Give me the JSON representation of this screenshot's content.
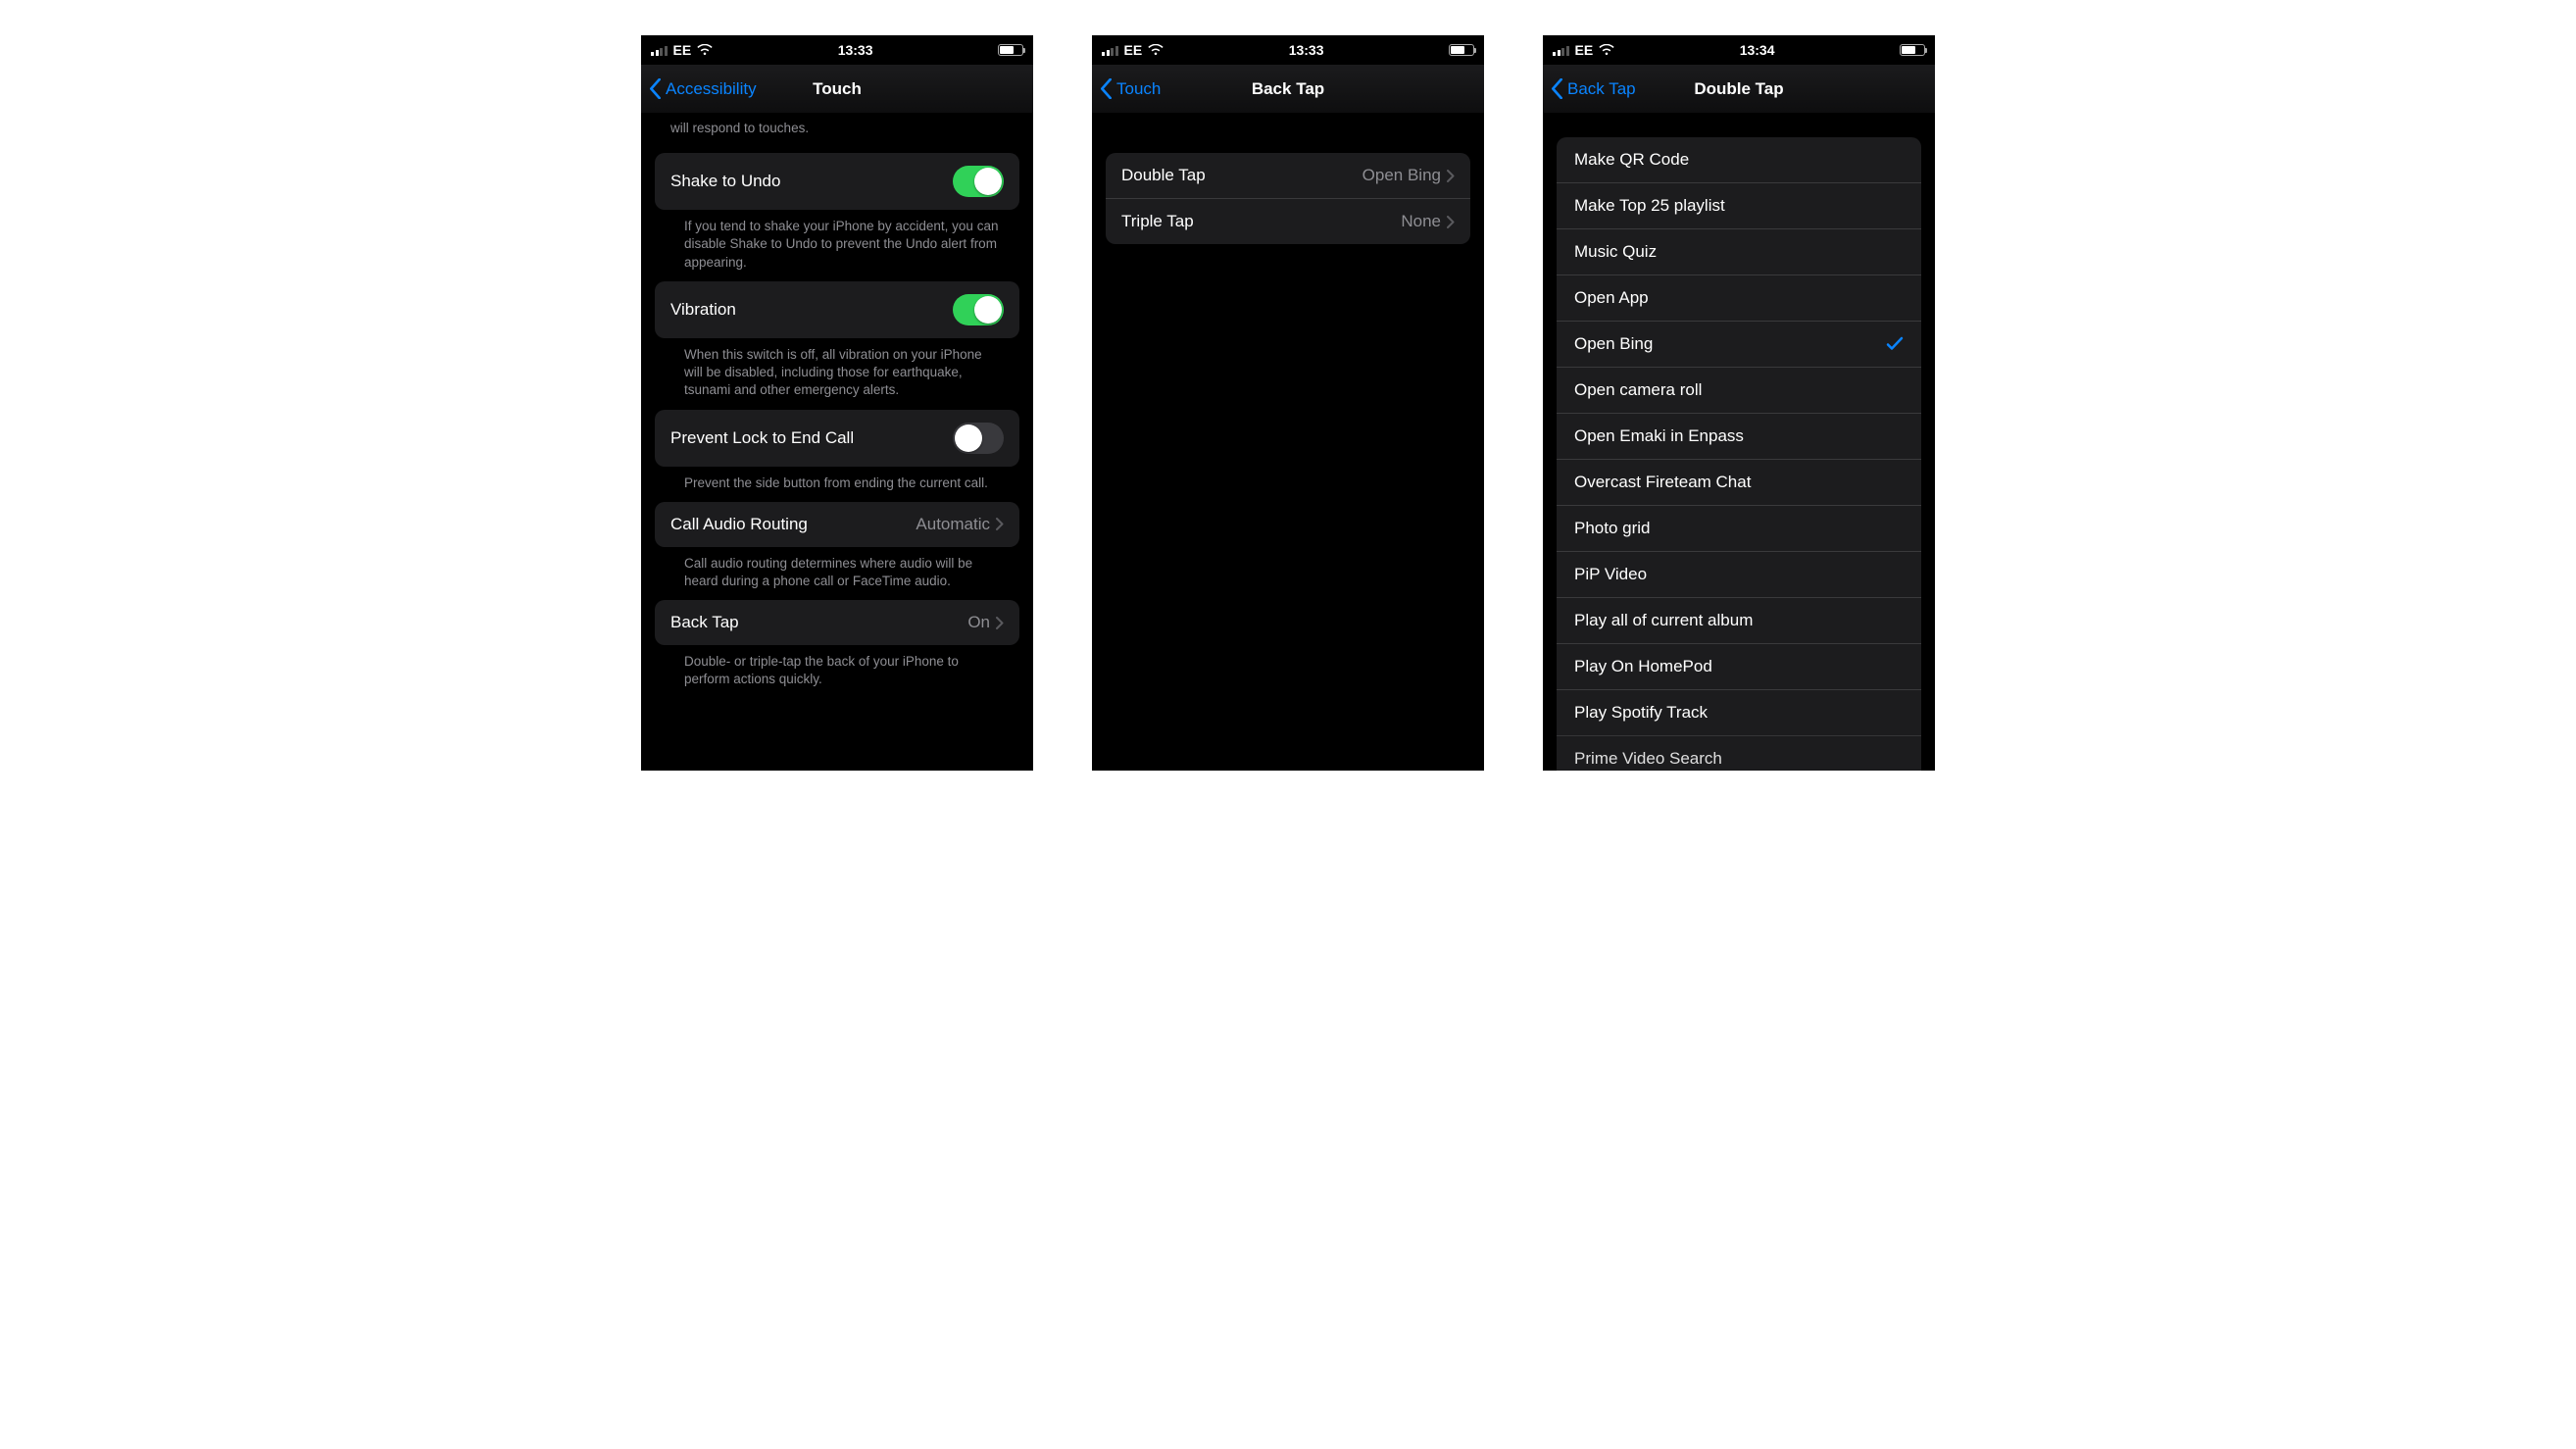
{
  "screens": [
    {
      "status": {
        "carrier": "EE",
        "time": "13:33"
      },
      "nav": {
        "back": "Accessibility",
        "title": "Touch"
      },
      "cut_text_top": "will respond to touches.",
      "rows": {
        "shake": {
          "label": "Shake to Undo",
          "footer": "If you tend to shake your iPhone by accident, you can disable Shake to Undo to prevent the Undo alert from appearing.",
          "on": true
        },
        "vibration": {
          "label": "Vibration",
          "footer": "When this switch is off, all vibration on your iPhone will be disabled, including those for earthquake, tsunami and other emergency alerts.",
          "on": true
        },
        "prevent_lock": {
          "label": "Prevent Lock to End Call",
          "footer": "Prevent the side button from ending the current call.",
          "on": false
        },
        "call_audio": {
          "label": "Call Audio Routing",
          "value": "Automatic",
          "footer": "Call audio routing determines where audio will be heard during a phone call or FaceTime audio."
        },
        "back_tap": {
          "label": "Back Tap",
          "value": "On",
          "footer": "Double- or triple-tap the back of your iPhone to perform actions quickly."
        }
      }
    },
    {
      "status": {
        "carrier": "EE",
        "time": "13:33"
      },
      "nav": {
        "back": "Touch",
        "title": "Back Tap"
      },
      "options": {
        "double_tap": {
          "label": "Double Tap",
          "value": "Open Bing"
        },
        "triple_tap": {
          "label": "Triple Tap",
          "value": "None"
        }
      }
    },
    {
      "status": {
        "carrier": "EE",
        "time": "13:34"
      },
      "nav": {
        "back": "Back Tap",
        "title": "Double Tap"
      },
      "selected": "Open Bing",
      "items": [
        "Make QR Code",
        "Make Top 25 playlist",
        "Music Quiz",
        "Open App",
        "Open Bing",
        "Open camera roll",
        "Open Emaki in Enpass",
        "Overcast Fireteam Chat",
        "Photo grid",
        "PiP Video",
        "Play all of current album",
        "Play On HomePod",
        "Play Spotify Track",
        "Prime Video Search"
      ]
    }
  ]
}
